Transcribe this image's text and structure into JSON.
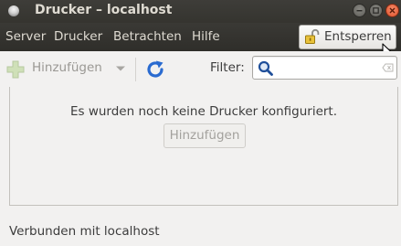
{
  "window": {
    "title": "Drucker – localhost"
  },
  "menubar": {
    "items": [
      "Server",
      "Drucker",
      "Betrachten",
      "Hilfe"
    ],
    "unlock_label": "Entsperren"
  },
  "toolbar": {
    "add_label": "Hinzufügen",
    "filter_label": "Filter:",
    "search_value": "",
    "search_placeholder": ""
  },
  "main": {
    "empty_message": "Es wurden noch keine Drucker konfiguriert.",
    "add_button_label": "Hinzufügen"
  },
  "statusbar": {
    "text": "Verbunden mit localhost"
  },
  "icons": {
    "app": "printer-app-icon",
    "minimize": "minimize-icon",
    "maximize": "maximize-icon",
    "close": "close-icon",
    "unlock": "unlock-icon",
    "add": "add-icon",
    "dropdown": "chevron-down-icon",
    "refresh": "refresh-icon",
    "search": "search-icon",
    "clear": "clear-icon"
  },
  "colors": {
    "titlebar": "#3e3d39",
    "window_bg": "#f2f1f0",
    "close_button": "#e0502a",
    "accent_blue": "#2a6bd0"
  }
}
